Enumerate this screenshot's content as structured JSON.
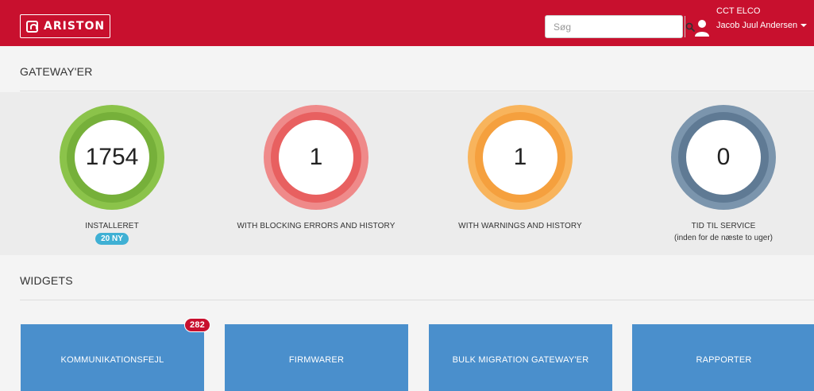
{
  "header": {
    "logo_text": "ARISTON",
    "search_placeholder": "Søg",
    "user_org": "CCT ELCO",
    "user_name": "Jacob Juul Andersen",
    "brand_color": "#c8102e"
  },
  "gateways": {
    "title": "GATEWAY'ER",
    "stats": [
      {
        "value": "1754",
        "label": "INSTALLERET",
        "badge": "20 NY",
        "color": "#8bc34a"
      },
      {
        "value": "1",
        "label": "WITH BLOCKING ERRORS AND HISTORY",
        "color": "#e86060"
      },
      {
        "value": "1",
        "label": "WITH WARNINGS AND HISTORY",
        "color": "#f5a03e"
      },
      {
        "value": "0",
        "label": "TID TIL SERVICE",
        "sublabel": "(inden for de næste to uger)",
        "color": "#5f7a94"
      }
    ]
  },
  "widgets": {
    "title": "WIDGETS",
    "tiles": [
      {
        "label": "KOMMUNIKATIONSFEJL",
        "badge": "282"
      },
      {
        "label": "FIRMWARER"
      },
      {
        "label": "BULK MIGRATION GATEWAY'ER"
      },
      {
        "label": "RAPPORTER"
      }
    ],
    "tile_color": "#4a8fcc"
  }
}
